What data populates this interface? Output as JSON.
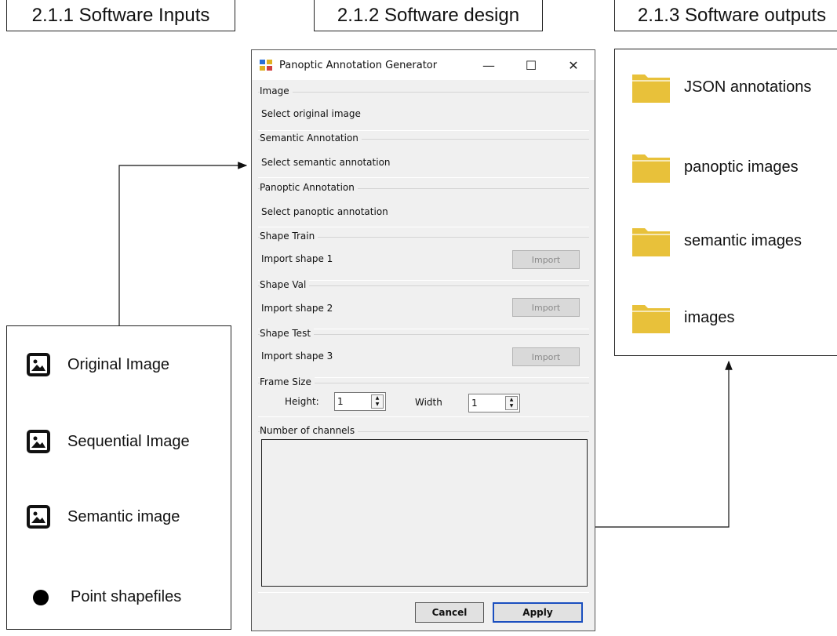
{
  "titles": {
    "inputs": "2.1.1 Software Inputs",
    "design": "2.1.2 Software design",
    "outputs": "2.1.3 Software outputs"
  },
  "inputs": {
    "items": [
      {
        "label": "Original Image",
        "icon": "image-icon"
      },
      {
        "label": "Sequential Image",
        "icon": "image-icon"
      },
      {
        "label": "Semantic image",
        "icon": "image-icon"
      },
      {
        "label": "Point shapefiles",
        "icon": "point-icon"
      }
    ]
  },
  "outputs": {
    "items": [
      {
        "label": "JSON annotations",
        "icon": "folder-icon"
      },
      {
        "label": "panoptic images",
        "icon": "folder-icon"
      },
      {
        "label": "semantic images",
        "icon": "folder-icon"
      },
      {
        "label": "images",
        "icon": "folder-icon"
      }
    ],
    "folder_color": "#e8c13a"
  },
  "dialog": {
    "title": "Panoptic Annotation Generator",
    "controls": {
      "minimize": "—",
      "maximize": "☐",
      "close": "✕"
    },
    "groups": {
      "image": {
        "label": "Image",
        "text": "Select original image"
      },
      "semantic": {
        "label": "Semantic Annotation",
        "text": "Select semantic annotation"
      },
      "panoptic": {
        "label": "Panoptic Annotation",
        "text": "Select panoptic annotation"
      },
      "shape_train": {
        "label": "Shape Train",
        "text": "Import shape 1",
        "button": "Import"
      },
      "shape_val": {
        "label": "Shape Val",
        "text": "Import shape 2",
        "button": "Import"
      },
      "shape_test": {
        "label": "Shape Test",
        "text": "Import shape 3",
        "button": "Import"
      },
      "frame_size": {
        "label": "Frame Size",
        "height_label": "Height:",
        "height_value": "1",
        "width_label": "Width",
        "width_value": "1"
      },
      "channels": {
        "label": "Number of channels"
      }
    },
    "buttons": {
      "cancel": "Cancel",
      "apply": "Apply"
    },
    "apply_border_color": "#1b4fbf"
  }
}
